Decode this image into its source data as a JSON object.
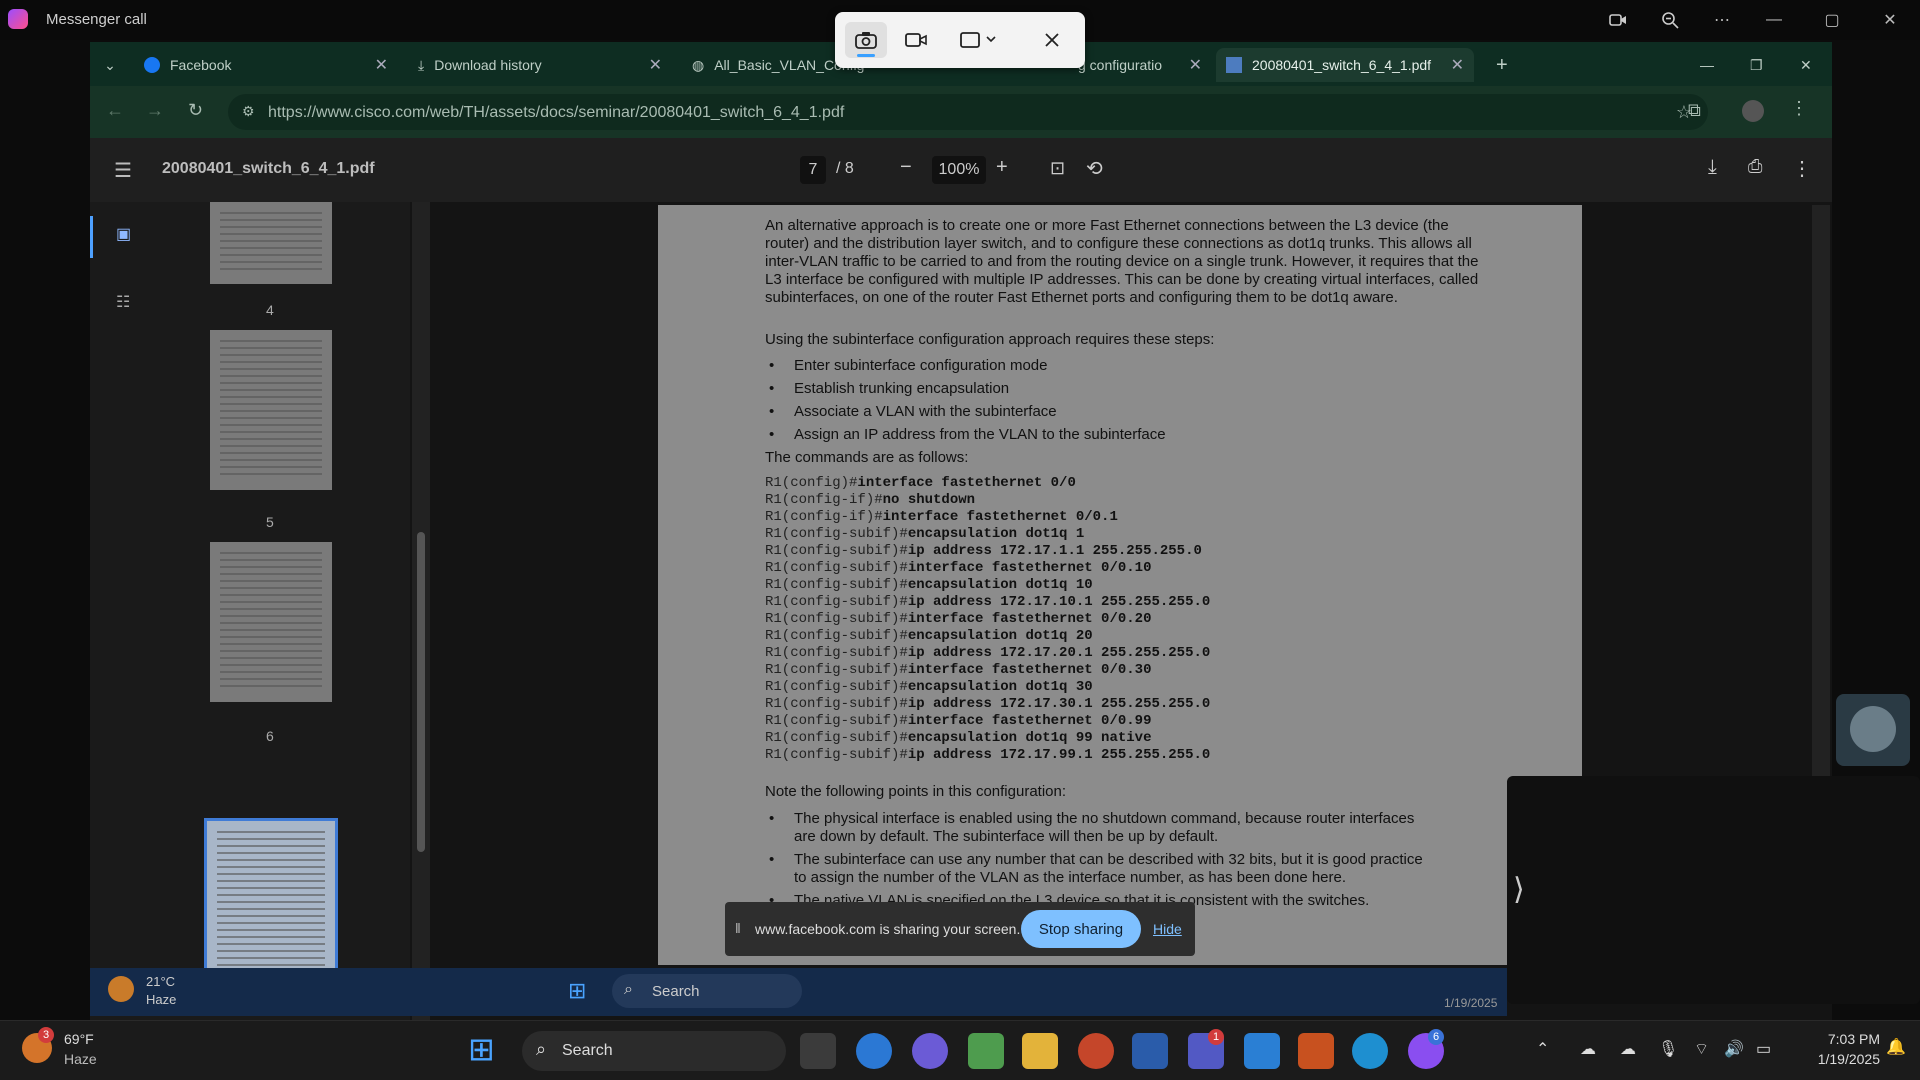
{
  "messenger": {
    "title": "Messenger call"
  },
  "tabs": [
    {
      "label": "Facebook"
    },
    {
      "label": "Download history"
    },
    {
      "label": "All_Basic_VLAN_Config"
    },
    {
      "label": "g configuratio"
    },
    {
      "label": "20080401_switch_6_4_1.pdf"
    }
  ],
  "address": {
    "url": "https://www.cisco.com/web/TH/assets/docs/seminar/20080401_switch_6_4_1.pdf"
  },
  "pdf": {
    "filename": "20080401_switch_6_4_1.pdf",
    "current_page": "7",
    "total_pages": "/ 8",
    "zoom": "100%",
    "thumbnails": [
      "4",
      "5",
      "6",
      "7"
    ],
    "para1": "An alternative approach is to create one or more Fast Ethernet connections between the L3 device (the router) and the distribution layer switch, and to configure these connections as dot1q trunks. This allows all inter-VLAN traffic to be carried to and from the routing device on a single trunk. However, it requires that the L3 interface be configured with multiple IP addresses. This can be done by creating virtual interfaces, called subinterfaces, on one of the router Fast Ethernet ports and configuring them to be dot1q aware.",
    "para2": "Using the subinterface configuration approach requires these steps:",
    "steps": [
      "Enter subinterface configuration mode",
      "Establish trunking encapsulation",
      "Associate a VLAN with the subinterface",
      "Assign an IP address from the VLAN to the subinterface"
    ],
    "para3": "The commands are as follows:",
    "code": [
      {
        "p": "R1(config)#",
        "c": "interface fastethernet 0/0"
      },
      {
        "p": "R1(config-if)#",
        "c": "no shutdown"
      },
      {
        "p": "R1(config-if)#",
        "c": "interface fastethernet 0/0.1"
      },
      {
        "p": "R1(config-subif)#",
        "c": "encapsulation dot1q 1"
      },
      {
        "p": "R1(config-subif)#",
        "c": "ip address 172.17.1.1 255.255.255.0"
      },
      {
        "p": "R1(config-subif)#",
        "c": "interface fastethernet 0/0.10"
      },
      {
        "p": "R1(config-subif)#",
        "c": "encapsulation dot1q 10"
      },
      {
        "p": "R1(config-subif)#",
        "c": "ip address 172.17.10.1 255.255.255.0"
      },
      {
        "p": "R1(config-subif)#",
        "c": "interface fastethernet 0/0.20"
      },
      {
        "p": "R1(config-subif)#",
        "c": "encapsulation dot1q 20"
      },
      {
        "p": "R1(config-subif)#",
        "c": "ip address 172.17.20.1 255.255.255.0"
      },
      {
        "p": "R1(config-subif)#",
        "c": "interface fastethernet 0/0.30"
      },
      {
        "p": "R1(config-subif)#",
        "c": "encapsulation dot1q 30"
      },
      {
        "p": "R1(config-subif)#",
        "c": "ip address 172.17.30.1 255.255.255.0"
      },
      {
        "p": "R1(config-subif)#",
        "c": "interface fastethernet 0/0.99"
      },
      {
        "p": "R1(config-subif)#",
        "c": "encapsulation dot1q 99 native"
      },
      {
        "p": "R1(config-subif)#",
        "c": "ip address 172.17.99.1 255.255.255.0"
      }
    ],
    "para4": "Note the following points in this configuration:",
    "notes": [
      "The physical interface is enabled using the no shutdown command, because router interfaces are down by default. The subinterface will then be up by default.",
      "The subinterface can use any number that can be described with 32 bits, but it is good practice to assign the number of the VLAN as the interface number, as has been done here.",
      "The native VLAN is specified on the L3 device so that it is consistent with the switches. communication between the router and"
    ]
  },
  "share": {
    "text": "www.facebook.com is sharing your screen.",
    "stop": "Stop sharing",
    "hide": "Hide"
  },
  "inner_taskbar": {
    "temp": "21°C",
    "weather": "Haze",
    "search": "Search",
    "date": "1/19/2025"
  },
  "taskbar": {
    "temp": "69°F",
    "weather": "Haze",
    "weather_badge": "3",
    "search": "Search",
    "time": "7:03 PM",
    "date": "1/19/2025",
    "teams_badge": "1",
    "messenger_badge": "6"
  },
  "colors": {
    "accent": "#3aa0ff",
    "stop_btn": "#7ec0ff"
  }
}
